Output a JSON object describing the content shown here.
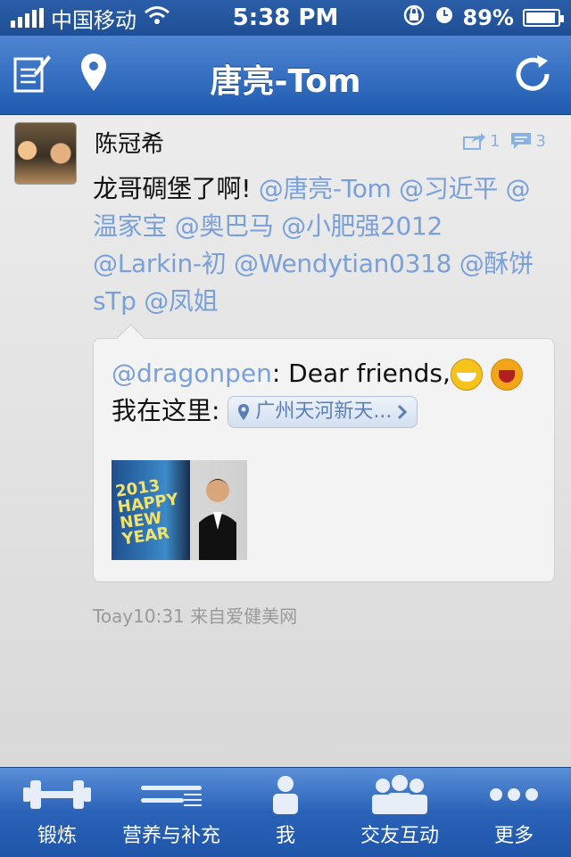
{
  "status_bar": {
    "carrier": "中国移动",
    "time": "5:38 PM",
    "battery": "89%",
    "battery_level": 0.89
  },
  "nav": {
    "title": "唐亮-Tom",
    "left_icons": [
      "compose-icon",
      "location-pin-icon"
    ],
    "right_icon": "refresh-icon"
  },
  "post": {
    "author": "陈冠希",
    "repost_count": "1",
    "comment_count": "3",
    "text_plain": "龙哥碉堡了啊!",
    "mentions": [
      "@唐亮-Tom",
      "@习近平",
      "@温家宝",
      "@奥巴马",
      "@小肥强2012",
      "@Larkin-初",
      "@Wendytian0318",
      "@酥饼sTp",
      "@凤姐"
    ],
    "quote": {
      "handle": "@dragonpen",
      "text_start": ": Dear friends,",
      "text_after_emoji": " 我在这里:",
      "location": "广州天河新天...",
      "image_text": [
        "2013",
        "HAPPY",
        "NEW",
        "YEAR"
      ]
    },
    "footer": "Toay10:31 来自爱健美网"
  },
  "tabs": [
    {
      "label": "锻炼",
      "icon": "dumbbell-icon"
    },
    {
      "label": "营养与补充",
      "icon": "knife-fork-icon"
    },
    {
      "label": "我",
      "icon": "person-icon"
    },
    {
      "label": "交友互动",
      "icon": "group-icon"
    },
    {
      "label": "更多",
      "icon": "more-dots-icon"
    }
  ],
  "colors": {
    "nav_blue": "#2f69bd",
    "mention": "#7aa0d8",
    "meta": "#9a9a9a"
  }
}
